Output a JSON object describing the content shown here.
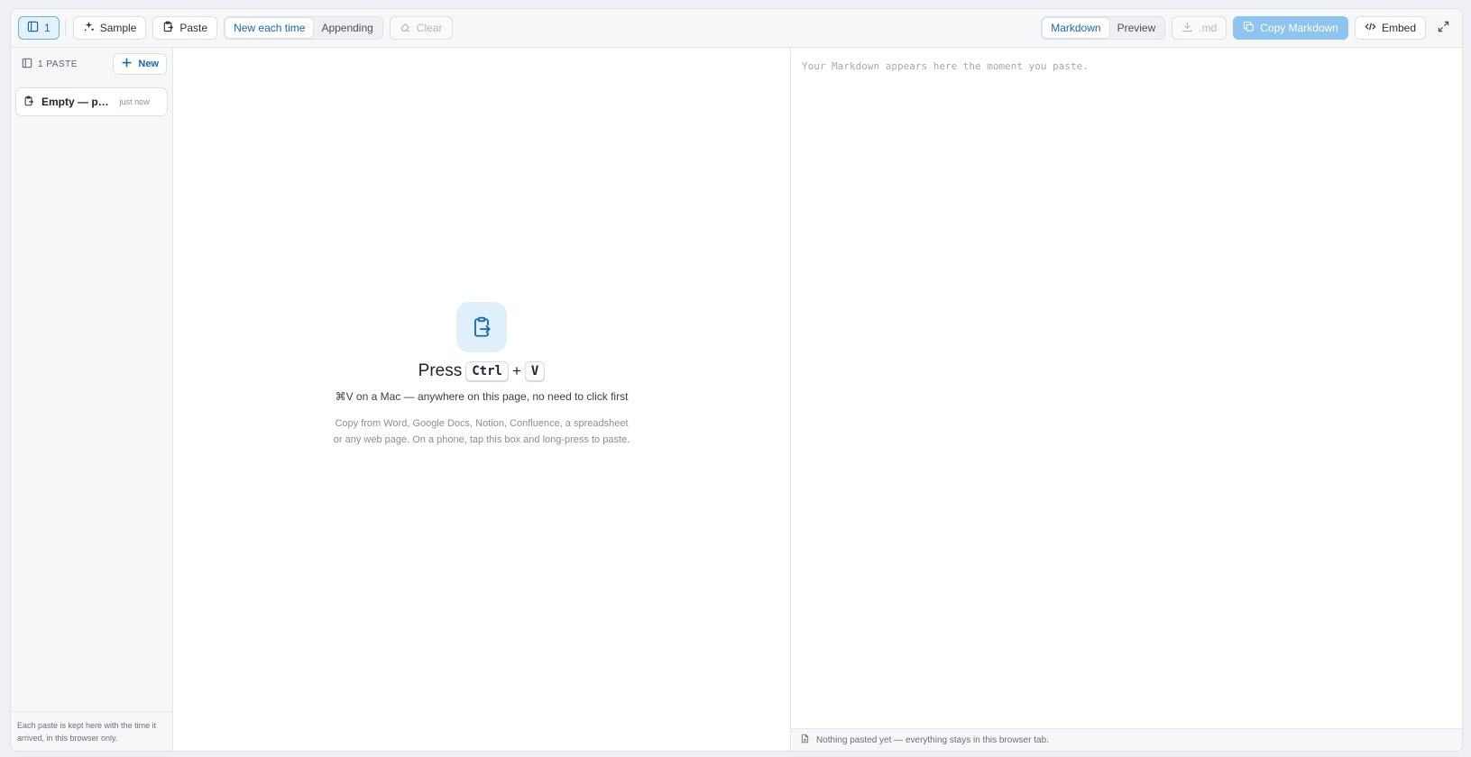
{
  "toolbar": {
    "sidebar_count": "1",
    "sample_label": "Sample",
    "paste_label": "Paste",
    "mode_options": [
      "New each time",
      "Appending"
    ],
    "mode_selected": "New each time",
    "clear_label": "Clear",
    "view_options": [
      "Markdown",
      "Preview"
    ],
    "view_selected": "Markdown",
    "download_label": ".md",
    "copy_label": "Copy Markdown",
    "embed_label": "Embed"
  },
  "sidebar": {
    "count_label": "1 PASTE",
    "new_label": "New",
    "items": [
      {
        "title": "Empty — p…",
        "time": "just now"
      }
    ],
    "footer": "Each paste is kept here with the time it arrived, in this browser only."
  },
  "input": {
    "press_label": "Press",
    "key1": "Ctrl",
    "plus": "+",
    "key2": "V",
    "mac_hint": "⌘V on a Mac — anywhere on this page, no need to click first",
    "description": "Copy from Word, Google Docs, Notion, Confluence, a spreadsheet or any web page. On a phone, tap this box and long-press to paste."
  },
  "output": {
    "placeholder": "Your Markdown appears here the moment you paste.",
    "status": "Nothing pasted yet — everything stays in this browser tab."
  },
  "colors": {
    "accent": "#1769b5",
    "accent_light": "#dff0fb",
    "copy_button_disabled": "#8ec4f0"
  },
  "icons": [
    "sidebar-icon",
    "sparkle-icon",
    "clipboard-icon",
    "eraser-icon",
    "download-icon",
    "copy-icon",
    "code-icon",
    "expand-icon",
    "plus-icon",
    "paste-icon",
    "document-icon"
  ]
}
